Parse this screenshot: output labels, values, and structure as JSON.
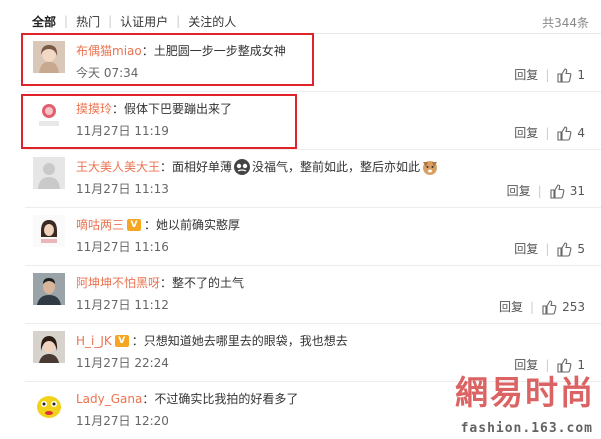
{
  "filters": [
    "全部",
    "热门",
    "认证用户",
    "关注的人"
  ],
  "total": "共344条",
  "reply_label": "回复",
  "comments": [
    {
      "user": "布偶猫miao",
      "colon": "：",
      "text": "土肥圆一步一步整成女神",
      "time": "今天 07:34",
      "likes": "1"
    },
    {
      "user": "摸摸玲",
      "colon": "：",
      "text": "假体下巴要蹦出来了",
      "time": "11月27日 11:19",
      "likes": "4"
    },
    {
      "user": "王大美人美大王",
      "colon": "：",
      "text_a": "面相好单薄",
      "text_b": "没福气，整前如此，整后亦如此",
      "time": "11月27日 11:13",
      "likes": "31"
    },
    {
      "user": "嘀咕两三",
      "colon": "：",
      "text": "她以前确实憨厚",
      "time": "11月27日 11:16",
      "likes": "5"
    },
    {
      "user": "阿坤坤不怕黑呀",
      "colon": "：",
      "text": "整不了的土气",
      "time": "11月27日 11:12",
      "likes": "253"
    },
    {
      "user": "H_i_JK",
      "colon": "：",
      "text": "只想知道她去哪里去的眼袋，我也想去",
      "time": "11月27日 22:24",
      "likes": "1"
    },
    {
      "user": "Lady_Gana",
      "colon": "：",
      "text": "不过确实比我拍的好看多了",
      "time": "11月27日 12:20",
      "likes": ""
    }
  ],
  "watermark": {
    "logo": "網易时尚",
    "url": "fashion.163.com"
  },
  "colors": {
    "username": "#eb7350",
    "highlight": "#e0232a"
  }
}
